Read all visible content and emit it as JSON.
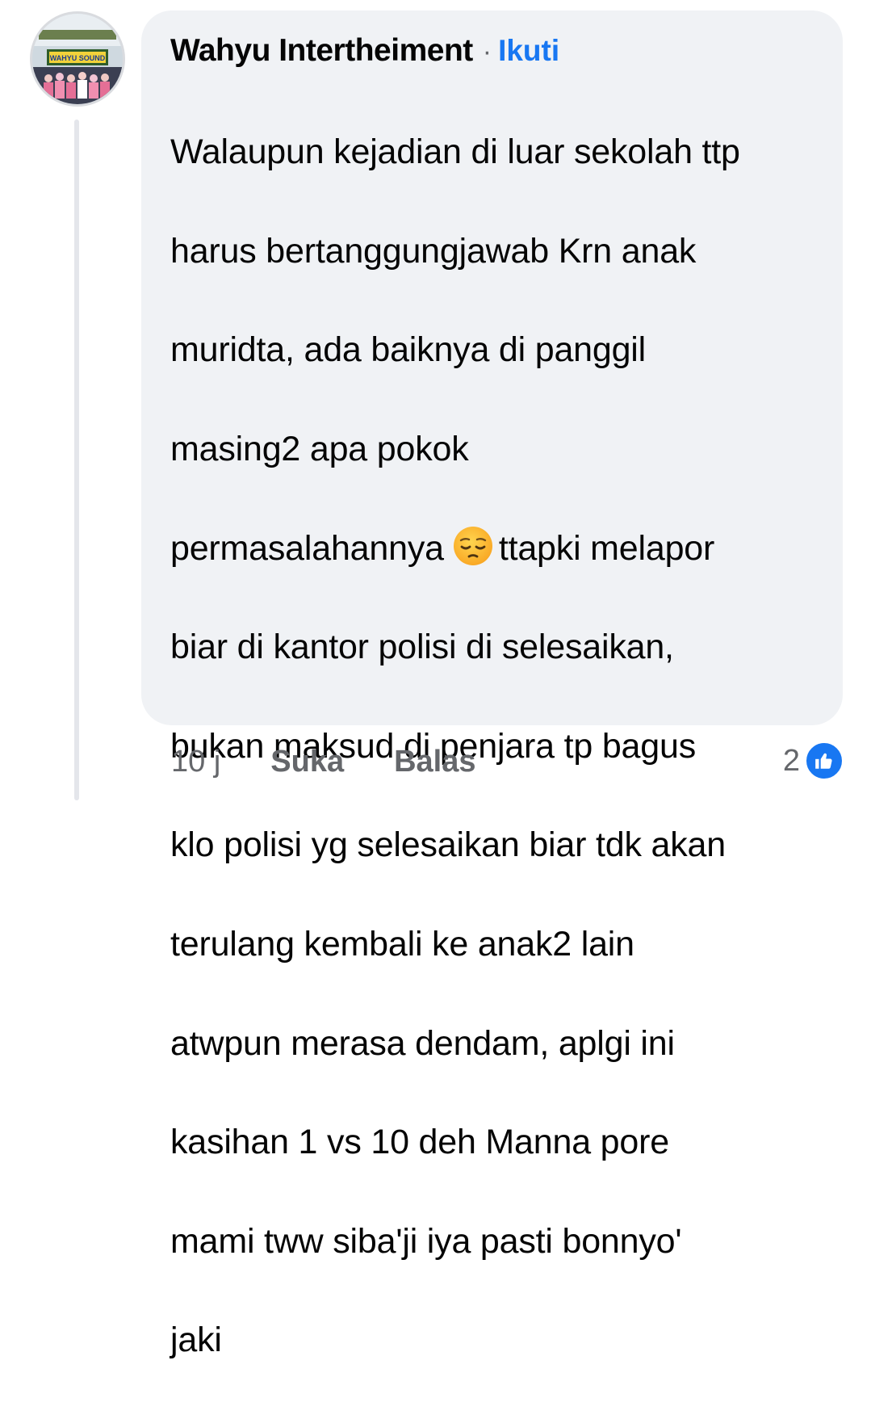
{
  "comment": {
    "author": "Wahyu Intertheiment",
    "separator": "·",
    "follow_label": "Ikuti",
    "avatar_label": "WAHYU SOUND",
    "text_lines": [
      "Walaupun kejadian di luar sekolah ttp",
      "harus bertanggungjawab Krn anak",
      "muridta, ada baiknya di panggil",
      "masing2 apa pokok",
      "permasalahannya",
      "ttapki melapor",
      "biar di kantor polisi di selesaikan,",
      "bukan maksud di penjara tp bagus",
      "klo polisi yg selesaikan biar tdk akan",
      "terulang kembali ke anak2 lain",
      "atwpun merasa dendam, aplgi ini",
      "kasihan 1 vs 10 deh Manna pore",
      "mami tww siba'ji iya pasti bonnyo'",
      "jaki"
    ],
    "emoji": "pensive-face-icon"
  },
  "actions": {
    "time": "10 j",
    "like_label": "Suka",
    "reply_label": "Balas"
  },
  "reactions": {
    "count": "2",
    "type": "like-icon"
  },
  "colors": {
    "bubble": "#f0f2f5",
    "accent": "#1877f2",
    "muted": "#65676b"
  }
}
